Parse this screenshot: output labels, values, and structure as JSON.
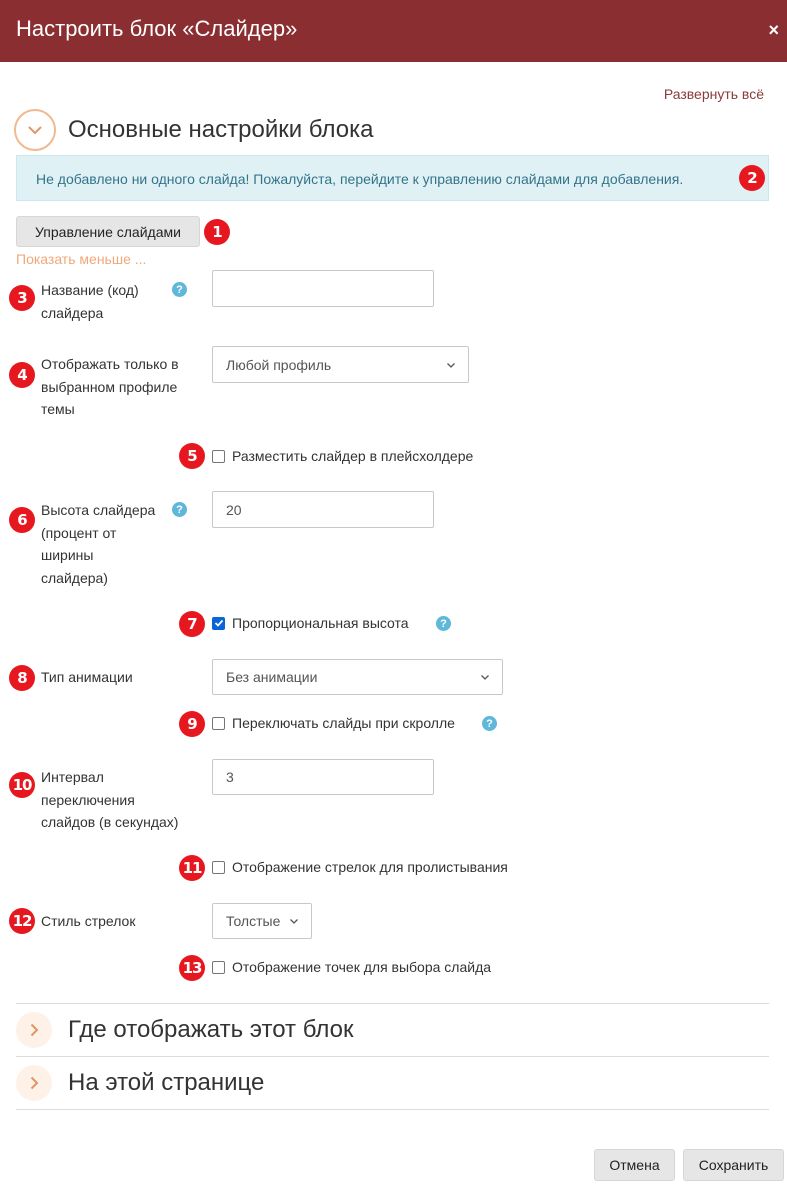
{
  "header": {
    "title": "Настроить блок «Слайдер»",
    "close_label": "×"
  },
  "expand_all": "Развернуть всё",
  "sections": {
    "main": {
      "title": "Основные настройки блока"
    },
    "where": {
      "title": "Где отображать этот блок"
    },
    "this_page": {
      "title": "На этой странице"
    }
  },
  "alert": {
    "text": "Не добавлено ни одного слайда! Пожалуйста, перейдите к управлению слайдами для добавления."
  },
  "manage_button": "Управление слайдами",
  "show_less": "Показать меньше ...",
  "fields": {
    "slider_name": {
      "label_lines": [
        "Название (код)",
        "слайдера"
      ],
      "value": ""
    },
    "profile": {
      "label_lines": [
        "Отображать только в",
        "выбранном профиле",
        "темы"
      ],
      "value": "Любой профиль"
    },
    "placeholder": {
      "label": "Разместить слайдер в плейсхолдере",
      "checked": false
    },
    "height": {
      "label_lines": [
        "Высота слайдера",
        "(процент от",
        "ширины",
        "слайдера)"
      ],
      "value": "20"
    },
    "proportional": {
      "label": "Пропорциональная высота",
      "checked": true
    },
    "animation": {
      "label": "Тип анимации",
      "value": "Без анимации"
    },
    "scroll_switch": {
      "label": "Переключать слайды при скролле",
      "checked": false
    },
    "interval": {
      "label_lines": [
        "Интервал",
        "переключения",
        "слайдов (в секундах)"
      ],
      "value": "3"
    },
    "arrows": {
      "label": "Отображение стрелок для пролистывания",
      "checked": false
    },
    "arrow_style": {
      "label": "Стиль стрелок",
      "value": "Толстые"
    },
    "dots": {
      "label": "Отображение точек для выбора слайда",
      "checked": false
    }
  },
  "help_glyph": "?",
  "badges": [
    "1",
    "2",
    "3",
    "4",
    "5",
    "6",
    "7",
    "8",
    "9",
    "10",
    "11",
    "12",
    "13"
  ],
  "footer": {
    "cancel": "Отмена",
    "save": "Сохранить"
  },
  "colors": {
    "header_bg": "#8a2e31",
    "accent_orange": "#efa87a",
    "badge_red": "#e6171f",
    "alert_bg": "#e0f1f5",
    "help_blue": "#5fb7d9"
  },
  "icons": {
    "section_open": "chevron-down-icon",
    "section_closed": "chevron-right-icon",
    "select": "chevron-down-icon",
    "close": "close-icon"
  }
}
